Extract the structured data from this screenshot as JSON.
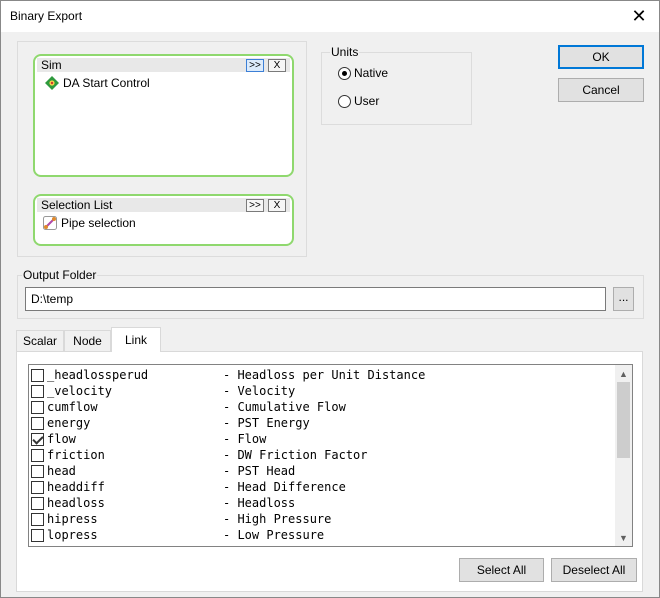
{
  "window": {
    "title": "Binary Export",
    "close_glyph": "✕"
  },
  "sim_box": {
    "title": "Sim",
    "expand_label": ">>",
    "remove_label": "X",
    "items": [
      {
        "label": "DA Start Control",
        "icon": "sim-scenario-icon"
      }
    ]
  },
  "selection_box": {
    "title": "Selection List",
    "expand_label": ">>",
    "remove_label": "X",
    "items": [
      {
        "label": "Pipe selection",
        "icon": "pipe-selection-icon"
      }
    ]
  },
  "units": {
    "title": "Units",
    "options": [
      {
        "label": "Native",
        "selected": true
      },
      {
        "label": "User",
        "selected": false
      }
    ]
  },
  "buttons": {
    "ok": "OK",
    "cancel": "Cancel",
    "browse": "...",
    "select_all": "Select All",
    "deselect_all": "Deselect All"
  },
  "output_folder": {
    "label": "Output Folder",
    "value": "D:\\temp"
  },
  "tabs": [
    {
      "label": "Scalar",
      "active": false
    },
    {
      "label": "Node",
      "active": false
    },
    {
      "label": "Link",
      "active": true
    }
  ],
  "fields": [
    {
      "name": "_headlossperud",
      "desc": "- Headloss per Unit Distance",
      "checked": false
    },
    {
      "name": "_velocity",
      "desc": "- Velocity",
      "checked": false
    },
    {
      "name": "cumflow",
      "desc": "- Cumulative Flow",
      "checked": false
    },
    {
      "name": "energy",
      "desc": "- PST Energy",
      "checked": false
    },
    {
      "name": "flow",
      "desc": "- Flow",
      "checked": true
    },
    {
      "name": "friction",
      "desc": "- DW Friction Factor",
      "checked": false
    },
    {
      "name": "head",
      "desc": "- PST Head",
      "checked": false
    },
    {
      "name": "headdiff",
      "desc": "- Head Difference",
      "checked": false
    },
    {
      "name": "headloss",
      "desc": "- Headloss",
      "checked": false
    },
    {
      "name": "hipress",
      "desc": "- High Pressure",
      "checked": false
    },
    {
      "name": "lopress",
      "desc": "- Low Pressure",
      "checked": false
    }
  ],
  "colors": {
    "group_border": "#8fd86e",
    "window_bg": "#f0f0f0"
  }
}
